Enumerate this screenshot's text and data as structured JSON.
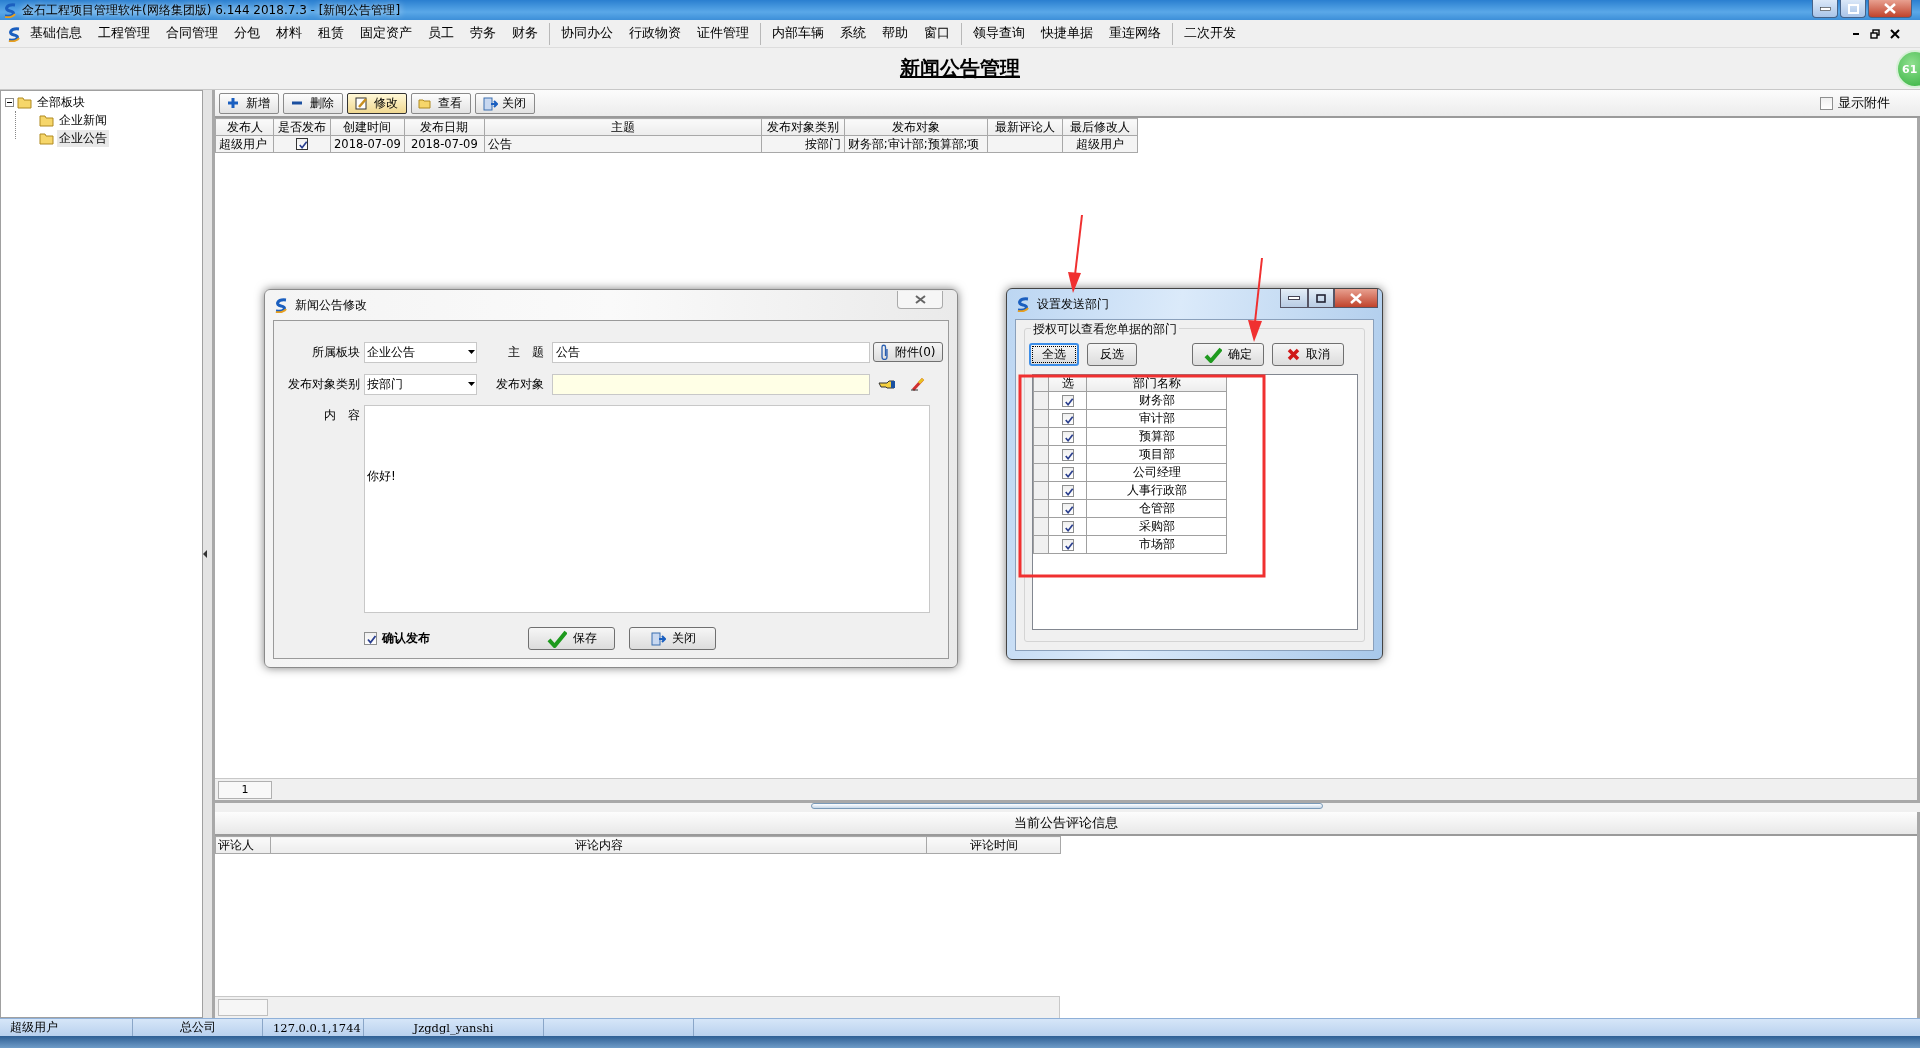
{
  "window": {
    "title": "金石工程项目管理软件(网络集团版) 6.144  2018.7.3 - [新闻公告管理]"
  },
  "menu_groups": [
    [
      "基础信息",
      "工程管理",
      "合同管理",
      "分包",
      "材料",
      "租赁",
      "固定资产",
      "员工",
      "劳务",
      "财务"
    ],
    [
      "协同办公",
      "行政物资",
      "证件管理"
    ],
    [
      "内部车辆",
      "系统",
      "帮助",
      "窗口"
    ],
    [
      "领导查询",
      "快捷单据",
      "重连网络"
    ],
    [
      "二次开发"
    ]
  ],
  "page_title": "新闻公告管理",
  "notification_badge": "61",
  "tree": {
    "label": "全部板块",
    "expanded": true,
    "children": [
      {
        "label": "企业新闻",
        "selected": false
      },
      {
        "label": "企业公告",
        "selected": true
      }
    ]
  },
  "toolbar": [
    {
      "label": "新增",
      "selected": false
    },
    {
      "label": "删除",
      "selected": false
    },
    {
      "label": "修改",
      "selected": true
    },
    {
      "label": "查看",
      "selected": false
    },
    {
      "label": "关闭",
      "selected": false
    }
  ],
  "show_attachments": {
    "label": "显示附件",
    "checked": false
  },
  "table": {
    "columns": [
      "发布人",
      "是否发布",
      "创建时间",
      "发布日期",
      "主题",
      "发布对象类别",
      "发布对象",
      "最新评论人",
      "最后修改人"
    ],
    "rows": [
      {
        "publisher": "超级用户",
        "published": true,
        "created": "2018-07-09",
        "date": "2018-07-09",
        "subject": "公告",
        "target_type": "按部门",
        "targets": "财务部;审计部;预算部;项",
        "last_modifier": "超级用户"
      }
    ]
  },
  "pager": {
    "page": "1"
  },
  "comments": {
    "title": "当前公告评论信息",
    "columns": [
      "评论人",
      "评论内容",
      "评论时间"
    ]
  },
  "status_bar": [
    "超级用户",
    "总公司",
    "127.0.0.1,1744",
    "Jzgdgl_yanshi"
  ],
  "edit_dialog": {
    "title": "新闻公告修改",
    "section_label": "所属板块",
    "section": "企业公告",
    "subject_label": "主　题",
    "subject": "公告",
    "attach_button": "附件(0)",
    "target_type_label": "发布对象类别",
    "target_type": "按部门",
    "target_label": "发布对象",
    "content_label": "内　容",
    "content": "你好!",
    "confirm": {
      "label": "确认发布",
      "checked": true
    },
    "buttons": [
      "保存",
      "关闭"
    ]
  },
  "dept_dialog": {
    "title": "设置发送部门",
    "group_label": "授权可以查看您单据的部门",
    "buttons": [
      {
        "label": "全选",
        "focused": true
      },
      {
        "label": "反选",
        "focused": false
      },
      {
        "label": "确定",
        "focused": false
      },
      {
        "label": "取消",
        "focused": false
      }
    ],
    "columns": [
      "选",
      "部门名称"
    ],
    "departments": [
      {
        "name": "财务部",
        "checked": true
      },
      {
        "name": "审计部",
        "checked": true
      },
      {
        "name": "预算部",
        "checked": true
      },
      {
        "name": "项目部",
        "checked": true
      },
      {
        "name": "公司经理",
        "checked": true
      },
      {
        "name": "人事行政部",
        "checked": true
      },
      {
        "name": "仓管部",
        "checked": true
      },
      {
        "name": "采购部",
        "checked": true
      },
      {
        "name": "市场部",
        "checked": true
      }
    ]
  }
}
